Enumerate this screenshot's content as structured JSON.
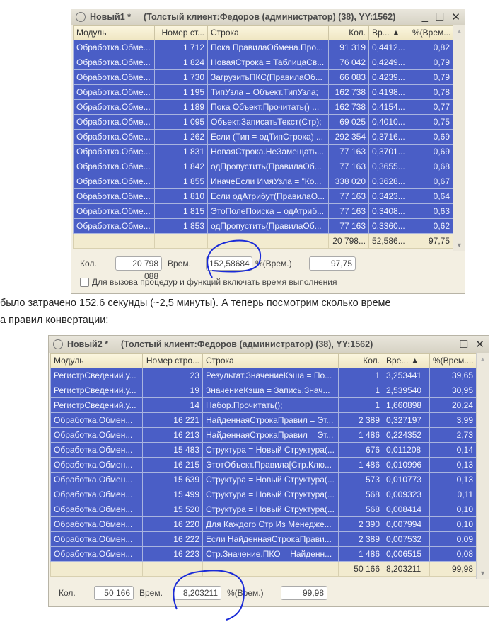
{
  "window1": {
    "title": "Новый1 *",
    "subtitle": "(Толстый клиент:Федоров (администратор) (38), YY:1562)",
    "columns": [
      "Модуль",
      "Номер ст...",
      "Строка",
      "Кол.",
      "Вр...  ▲",
      "%(Врем..."
    ],
    "rows": [
      [
        "Обработка.Обме...",
        "1 712",
        "Пока ПравилаОбмена.Про...",
        "91 319",
        "0,4412...",
        "0,82"
      ],
      [
        "Обработка.Обме...",
        "1 824",
        "НоваяСтрока = ТаблицаСв...",
        "76 042",
        "0,4249...",
        "0,79"
      ],
      [
        "Обработка.Обме...",
        "1 730",
        "ЗагрузитьПКС(ПравилаОб...",
        "66 083",
        "0,4239...",
        "0,79"
      ],
      [
        "Обработка.Обме...",
        "1 195",
        "ТипУзла = Объект.ТипУзла;",
        "162 738",
        "0,4198...",
        "0,78"
      ],
      [
        "Обработка.Обме...",
        "1 189",
        "Пока Объект.Прочитать() ...",
        "162 738",
        "0,4154...",
        "0,77"
      ],
      [
        "Обработка.Обме...",
        "1 095",
        "Объект.ЗаписатьТекст(Стр);",
        "69 025",
        "0,4010...",
        "0,75"
      ],
      [
        "Обработка.Обме...",
        "1 262",
        "Если (Тип = одТипСтрока) ...",
        "292 354",
        "0,3716...",
        "0,69"
      ],
      [
        "Обработка.Обме...",
        "1 831",
        "НоваяСтрока.НеЗамещать...",
        "77 163",
        "0,3701...",
        "0,69"
      ],
      [
        "Обработка.Обме...",
        "1 842",
        "одПропустить(ПравилаОб...",
        "77 163",
        "0,3655...",
        "0,68"
      ],
      [
        "Обработка.Обме...",
        "1 855",
        "ИначеЕсли ИмяУзла = \"Ко...",
        "338 020",
        "0,3628...",
        "0,67"
      ],
      [
        "Обработка.Обме...",
        "1 810",
        "Если одАтрибут(ПравилаО...",
        "77 163",
        "0,3423...",
        "0,64"
      ],
      [
        "Обработка.Обме...",
        "1 815",
        "ЭтоПолеПоиска = одАтриб...",
        "77 163",
        "0,3408...",
        "0,63"
      ],
      [
        "Обработка.Обме...",
        "1 853",
        "одПропустить(ПравилаОб...",
        "77 163",
        "0,3360...",
        "0,62"
      ]
    ],
    "totals": [
      "",
      "",
      "",
      "20 798...",
      "52,586...",
      "97,75"
    ],
    "kol_label": "Кол.",
    "kol_value": "20 798 088",
    "vrem_label": "Врем.",
    "vrem_value": "152,58684",
    "pct_label": "%(Врем.)",
    "pct_value": "97,75",
    "checkbox_label": "Для вызова процедур и функций включать время выполнения"
  },
  "text_line1": "было затрачено 152,6 секунды (~2,5 минуты). А теперь посмотрим сколько време",
  "text_line2": "а правил конвертации:",
  "window2": {
    "title": "Новый2 *",
    "subtitle": "(Толстый клиент:Федоров (администратор) (38), YY:1562)",
    "columns": [
      "Модуль",
      "Номер стро...",
      "Строка",
      "Кол.",
      "Вре...  ▲",
      "%(Врем...."
    ],
    "rows": [
      [
        "РегистрСведений.у...",
        "23",
        "Результат.ЗначениеКэша = По...",
        "1",
        "3,253441",
        "39,65"
      ],
      [
        "РегистрСведений.у...",
        "19",
        "ЗначениеКэша = Запись.Знач...",
        "1",
        "2,539540",
        "30,95"
      ],
      [
        "РегистрСведений.у...",
        "14",
        "Набор.Прочитать();",
        "1",
        "1,660898",
        "20,24"
      ],
      [
        "Обработка.Обмен...",
        "16 221",
        "НайденнаяСтрокаПравил = Эт...",
        "2 389",
        "0,327197",
        "3,99"
      ],
      [
        "Обработка.Обмен...",
        "16 213",
        "НайденнаяСтрокаПравил = Эт...",
        "1 486",
        "0,224352",
        "2,73"
      ],
      [
        "Обработка.Обмен...",
        "15 483",
        "Структура = Новый Структура(...",
        "676",
        "0,011208",
        "0,14"
      ],
      [
        "Обработка.Обмен...",
        "16 215",
        "ЭтотОбъект.Правила[Стр.Клю...",
        "1 486",
        "0,010996",
        "0,13"
      ],
      [
        "Обработка.Обмен...",
        "15 639",
        "Структура = Новый Структура(...",
        "573",
        "0,010773",
        "0,13"
      ],
      [
        "Обработка.Обмен...",
        "15 499",
        "Структура = Новый Структура(...",
        "568",
        "0,009323",
        "0,11"
      ],
      [
        "Обработка.Обмен...",
        "15 520",
        "Структура = Новый Структура(...",
        "568",
        "0,008414",
        "0,10"
      ],
      [
        "Обработка.Обмен...",
        "16 220",
        "Для Каждого Стр Из Менедже...",
        "2 390",
        "0,007994",
        "0,10"
      ],
      [
        "Обработка.Обмен...",
        "16 222",
        "Если НайденнаяСтрокаПрави...",
        "2 389",
        "0,007532",
        "0,09"
      ],
      [
        "Обработка.Обмен...",
        "16 223",
        "Стр.Значение.ПКО = Найденн...",
        "1 486",
        "0,006515",
        "0,08"
      ]
    ],
    "totals": [
      "",
      "",
      "",
      "50 166",
      "8,203211",
      "99,98"
    ],
    "kol_label": "Кол.",
    "kol_value": "50 166",
    "vrem_label": "Врем.",
    "vrem_value": "8,203211",
    "pct_label": "%(Врем.)",
    "pct_value": "99,98"
  },
  "colors": {
    "selection": "#4a5ec6",
    "annotation": "#1a2bd8"
  }
}
